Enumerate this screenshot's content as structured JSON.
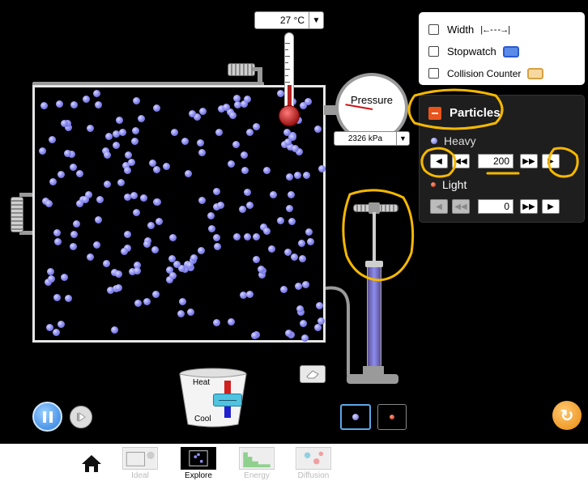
{
  "temperature": {
    "value": "27 °C",
    "arrow": "▼"
  },
  "pressure": {
    "title": "Pressure",
    "value": "2326 kPa",
    "arrow": "▼"
  },
  "tools": {
    "width_label": "Width",
    "width_icon": "|←- - -→|",
    "stopwatch_label": "Stopwatch",
    "collision_label": "Collision Counter"
  },
  "particles_panel": {
    "title": "Particles",
    "heavy_label": "Heavy",
    "heavy_count": "200",
    "light_label": "Light",
    "light_count": "0"
  },
  "bucket": {
    "heat_label": "Heat",
    "cool_label": "Cool"
  },
  "nav": {
    "tabs": [
      {
        "label": "Ideal"
      },
      {
        "label": "Explore"
      },
      {
        "label": "Energy"
      },
      {
        "label": "Diffusion"
      }
    ]
  },
  "colors": {
    "heavy_particle": "#8d8df0",
    "light_particle": "#e0502a",
    "annotation": "#f5b800",
    "reset": "#f0a020"
  }
}
